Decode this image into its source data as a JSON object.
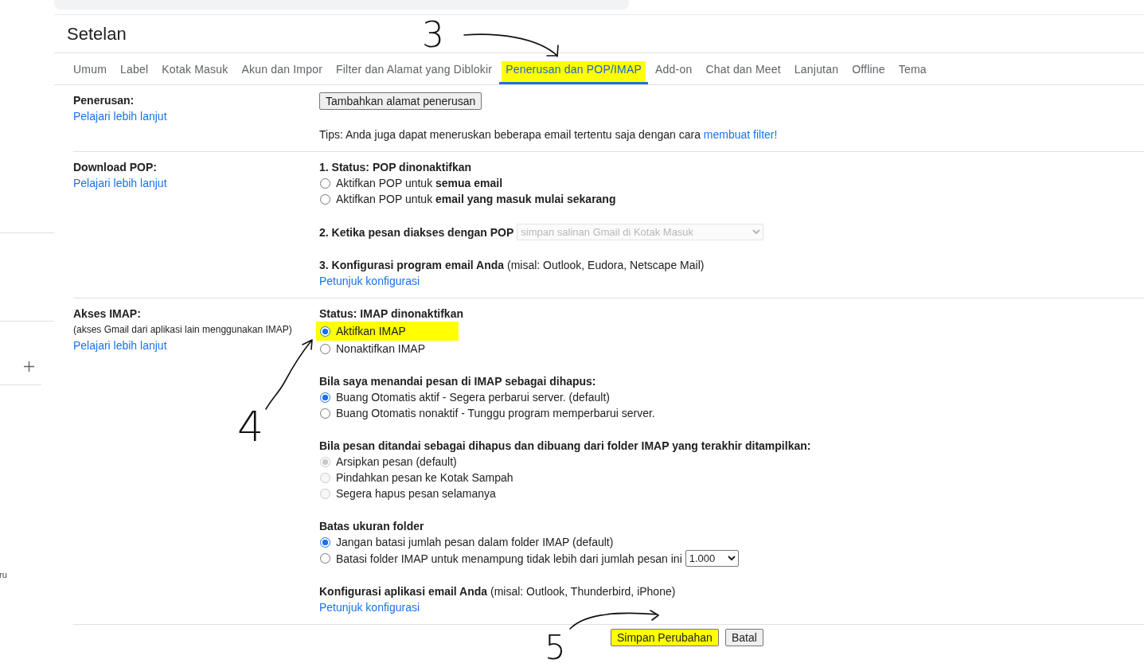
{
  "sidebar": {
    "cut_text": "ru"
  },
  "title": "Setelan",
  "tabs": [
    {
      "label": "Umum",
      "selected": false,
      "highlighted": false
    },
    {
      "label": "Label",
      "selected": false,
      "highlighted": false
    },
    {
      "label": "Kotak Masuk",
      "selected": false,
      "highlighted": false
    },
    {
      "label": "Akun dan Impor",
      "selected": false,
      "highlighted": false
    },
    {
      "label": "Filter dan Alamat yang Diblokir",
      "selected": false,
      "highlighted": false
    },
    {
      "label": "Penerusan dan POP/IMAP",
      "selected": true,
      "highlighted": true
    },
    {
      "label": "Add-on",
      "selected": false,
      "highlighted": false
    },
    {
      "label": "Chat dan Meet",
      "selected": false,
      "highlighted": false
    },
    {
      "label": "Lanjutan",
      "selected": false,
      "highlighted": false
    },
    {
      "label": "Offline",
      "selected": false,
      "highlighted": false
    },
    {
      "label": "Tema",
      "selected": false,
      "highlighted": false
    }
  ],
  "sections": [
    {
      "label": "Penerusan:",
      "link": "Pelajari lebih lanjut",
      "groups": [
        {
          "items": [
            {
              "kind": "button",
              "text": "Tambahkan alamat penerusan"
            }
          ]
        },
        {
          "items": [
            {
              "kind": "tip",
              "text": "Tips: Anda juga dapat meneruskan beberapa email tertentu saja dengan cara",
              "link": "membuat filter!"
            }
          ]
        }
      ]
    },
    {
      "label": "Download POP:",
      "link": "Pelajari lebih lanjut",
      "groups": [
        {
          "items": [
            {
              "kind": "heading",
              "text": "**1. Status: POP dinonaktifkan**"
            },
            {
              "kind": "radio",
              "text": "Aktifkan POP untuk **semua email**",
              "selected": false,
              "disabled": false,
              "highlighted": false
            },
            {
              "kind": "radio",
              "text": "Aktifkan POP untuk **email yang masuk mulai sekarang**",
              "selected": false,
              "disabled": false,
              "highlighted": false
            }
          ]
        },
        {
          "items": [
            {
              "kind": "select",
              "text": "**2. Ketika pesan diakses dengan POP**",
              "value": "simpan salinan Gmail di Kotak Masuk",
              "disabled": true
            }
          ]
        },
        {
          "items": [
            {
              "kind": "text",
              "text": "**3. Konfigurasi program email Anda** (misal: Outlook, Eudora, Netscape Mail)"
            },
            {
              "kind": "link",
              "text": "Petunjuk konfigurasi"
            }
          ]
        }
      ]
    },
    {
      "label": "Akses IMAP:",
      "note": "(akses Gmail dari aplikasi lain menggunakan IMAP)",
      "link": "Pelajari lebih lanjut",
      "groups": [
        {
          "items": [
            {
              "kind": "heading",
              "text": "**Status: IMAP dinonaktifkan**"
            },
            {
              "kind": "radio",
              "text": "Aktifkan IMAP",
              "selected": true,
              "disabled": false,
              "highlighted": true
            },
            {
              "kind": "radio",
              "text": "Nonaktifkan IMAP",
              "selected": false,
              "disabled": false,
              "highlighted": false
            }
          ]
        },
        {
          "items": [
            {
              "kind": "heading",
              "text": "**Bila saya menandai pesan di IMAP sebagai dihapus:**"
            },
            {
              "kind": "radio",
              "text": "Buang Otomatis aktif - Segera perbarui server. (default)",
              "selected": true,
              "disabled": false,
              "highlighted": false
            },
            {
              "kind": "radio",
              "text": "Buang Otomatis nonaktif - Tunggu program memperbarui server.",
              "selected": false,
              "disabled": false,
              "highlighted": false
            }
          ]
        },
        {
          "items": [
            {
              "kind": "heading",
              "text": "**Bila pesan ditandai sebagai dihapus dan dibuang dari folder IMAP yang terakhir ditampilkan:**"
            },
            {
              "kind": "radio",
              "text": "Arsipkan pesan (default)",
              "selected": true,
              "disabled": true,
              "highlighted": false
            },
            {
              "kind": "radio",
              "text": "Pindahkan pesan ke Kotak Sampah",
              "selected": false,
              "disabled": true,
              "highlighted": false
            },
            {
              "kind": "radio",
              "text": "Segera hapus pesan selamanya",
              "selected": false,
              "disabled": true,
              "highlighted": false
            }
          ]
        },
        {
          "items": [
            {
              "kind": "heading",
              "text": "**Batas ukuran folder**"
            },
            {
              "kind": "radio",
              "text": "Jangan batasi jumlah pesan dalam folder IMAP (default)",
              "selected": true,
              "disabled": false,
              "highlighted": false
            },
            {
              "kind": "radio",
              "text": "Batasi folder IMAP untuk menampung tidak lebih dari jumlah pesan ini",
              "selected": false,
              "disabled": false,
              "highlighted": false,
              "select": {
                "value": "1.000",
                "disabled": false
              }
            }
          ]
        },
        {
          "items": [
            {
              "kind": "text",
              "text": "**Konfigurasi aplikasi email Anda** (misal: Outlook, Thunderbird, iPhone)"
            },
            {
              "kind": "link",
              "text": "Petunjuk konfigurasi"
            }
          ]
        }
      ]
    }
  ],
  "footer": {
    "buttons": [
      {
        "label": "Simpan Perubahan",
        "highlighted": true
      },
      {
        "label": "Batal",
        "highlighted": false
      }
    ]
  },
  "annotations": [
    {
      "label": "3"
    },
    {
      "label": "4"
    },
    {
      "label": "5"
    }
  ]
}
